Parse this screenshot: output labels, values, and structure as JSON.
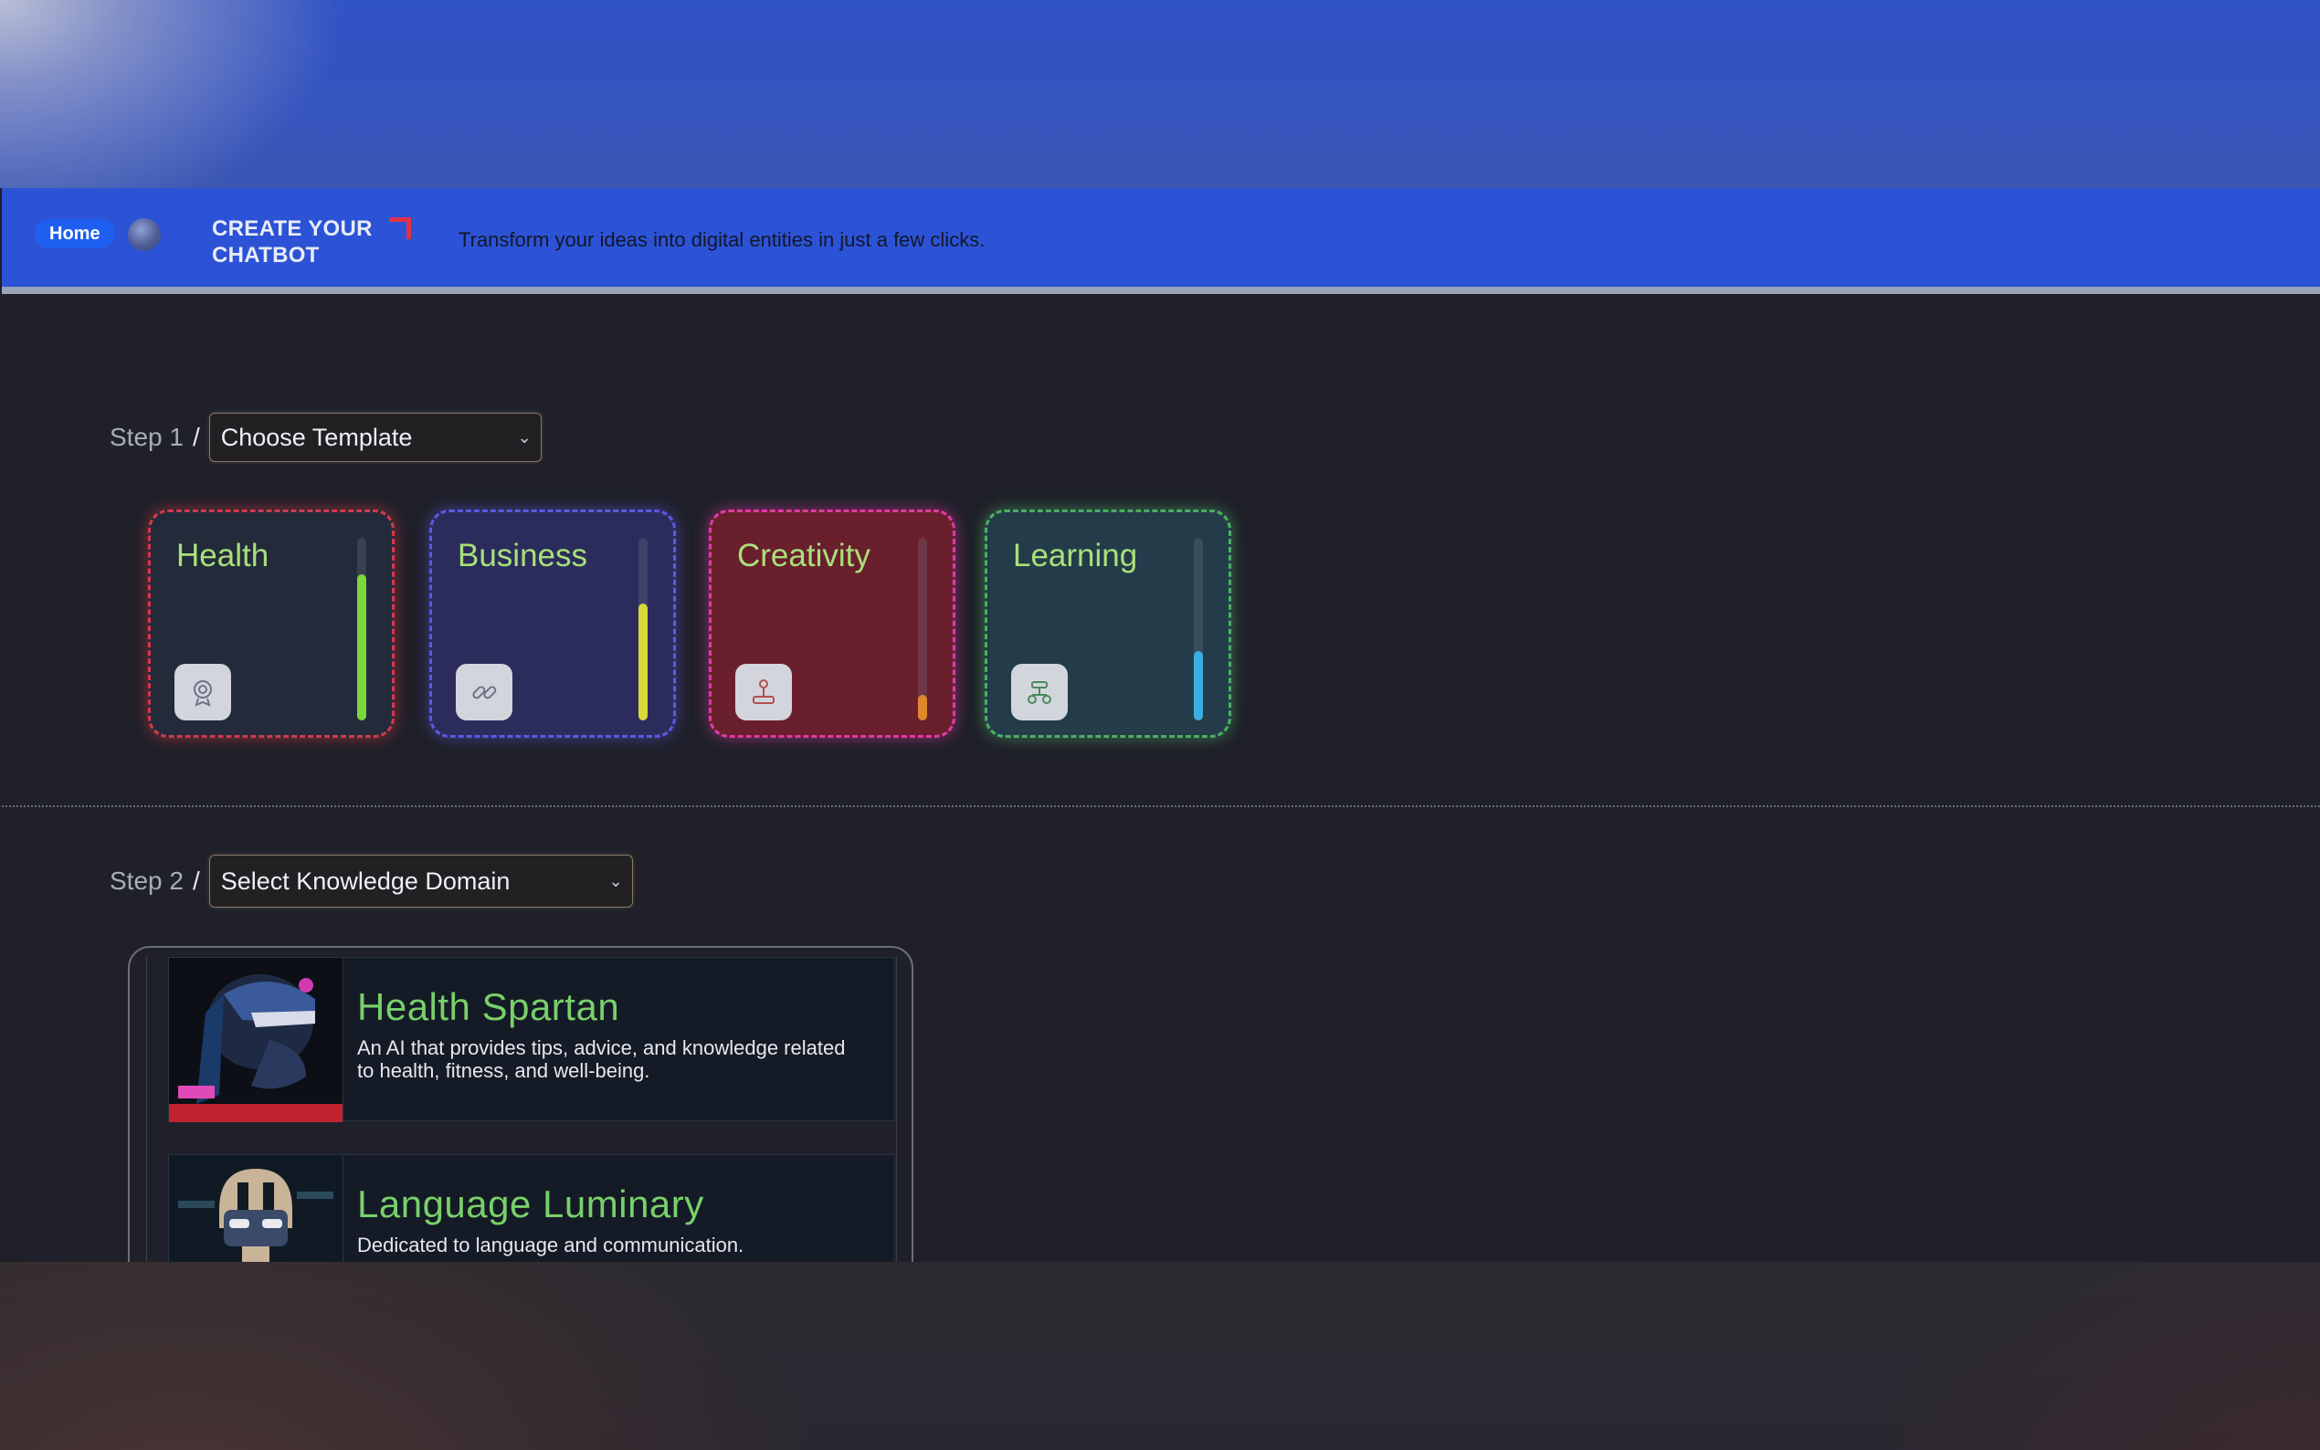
{
  "header": {
    "home_label": "Home",
    "brand_title": "CREATE YOUR CHATBOT",
    "tagline": "Transform your ideas into digital entities in just a few clicks."
  },
  "step1": {
    "label": "Step 1",
    "separator": "/",
    "select_value": "Choose Template"
  },
  "templates": [
    {
      "title": "Health",
      "icon": "gear-badge-icon",
      "border": "#d03a4a",
      "bg": "#232a3a",
      "bar_color": "#7ad63a",
      "level": 0.86
    },
    {
      "title": "Business",
      "icon": "link-icon",
      "border": "#5a5ae0",
      "bg": "#2c2c5c",
      "bar_color": "#d8d83a",
      "level": 0.68
    },
    {
      "title": "Creativity",
      "icon": "joystick-icon",
      "border": "#e03aa8",
      "bg": "#6a1f2c",
      "bar_color": "#e0892a",
      "level": 0.14
    },
    {
      "title": "Learning",
      "icon": "robot-arm-icon",
      "border": "#4ab060",
      "bg": "#243c4a",
      "bar_color": "#3aaee0",
      "level": 0.38
    }
  ],
  "step2": {
    "label": "Step 2",
    "separator": "/",
    "select_value": "Select Knowledge Domain"
  },
  "bots": [
    {
      "name": "Health Spartan",
      "description": "An AI that provides tips, advice, and knowledge related to health, fitness, and well-being."
    },
    {
      "name": "Language Luminary",
      "description": "Dedicated to language and communication."
    }
  ]
}
